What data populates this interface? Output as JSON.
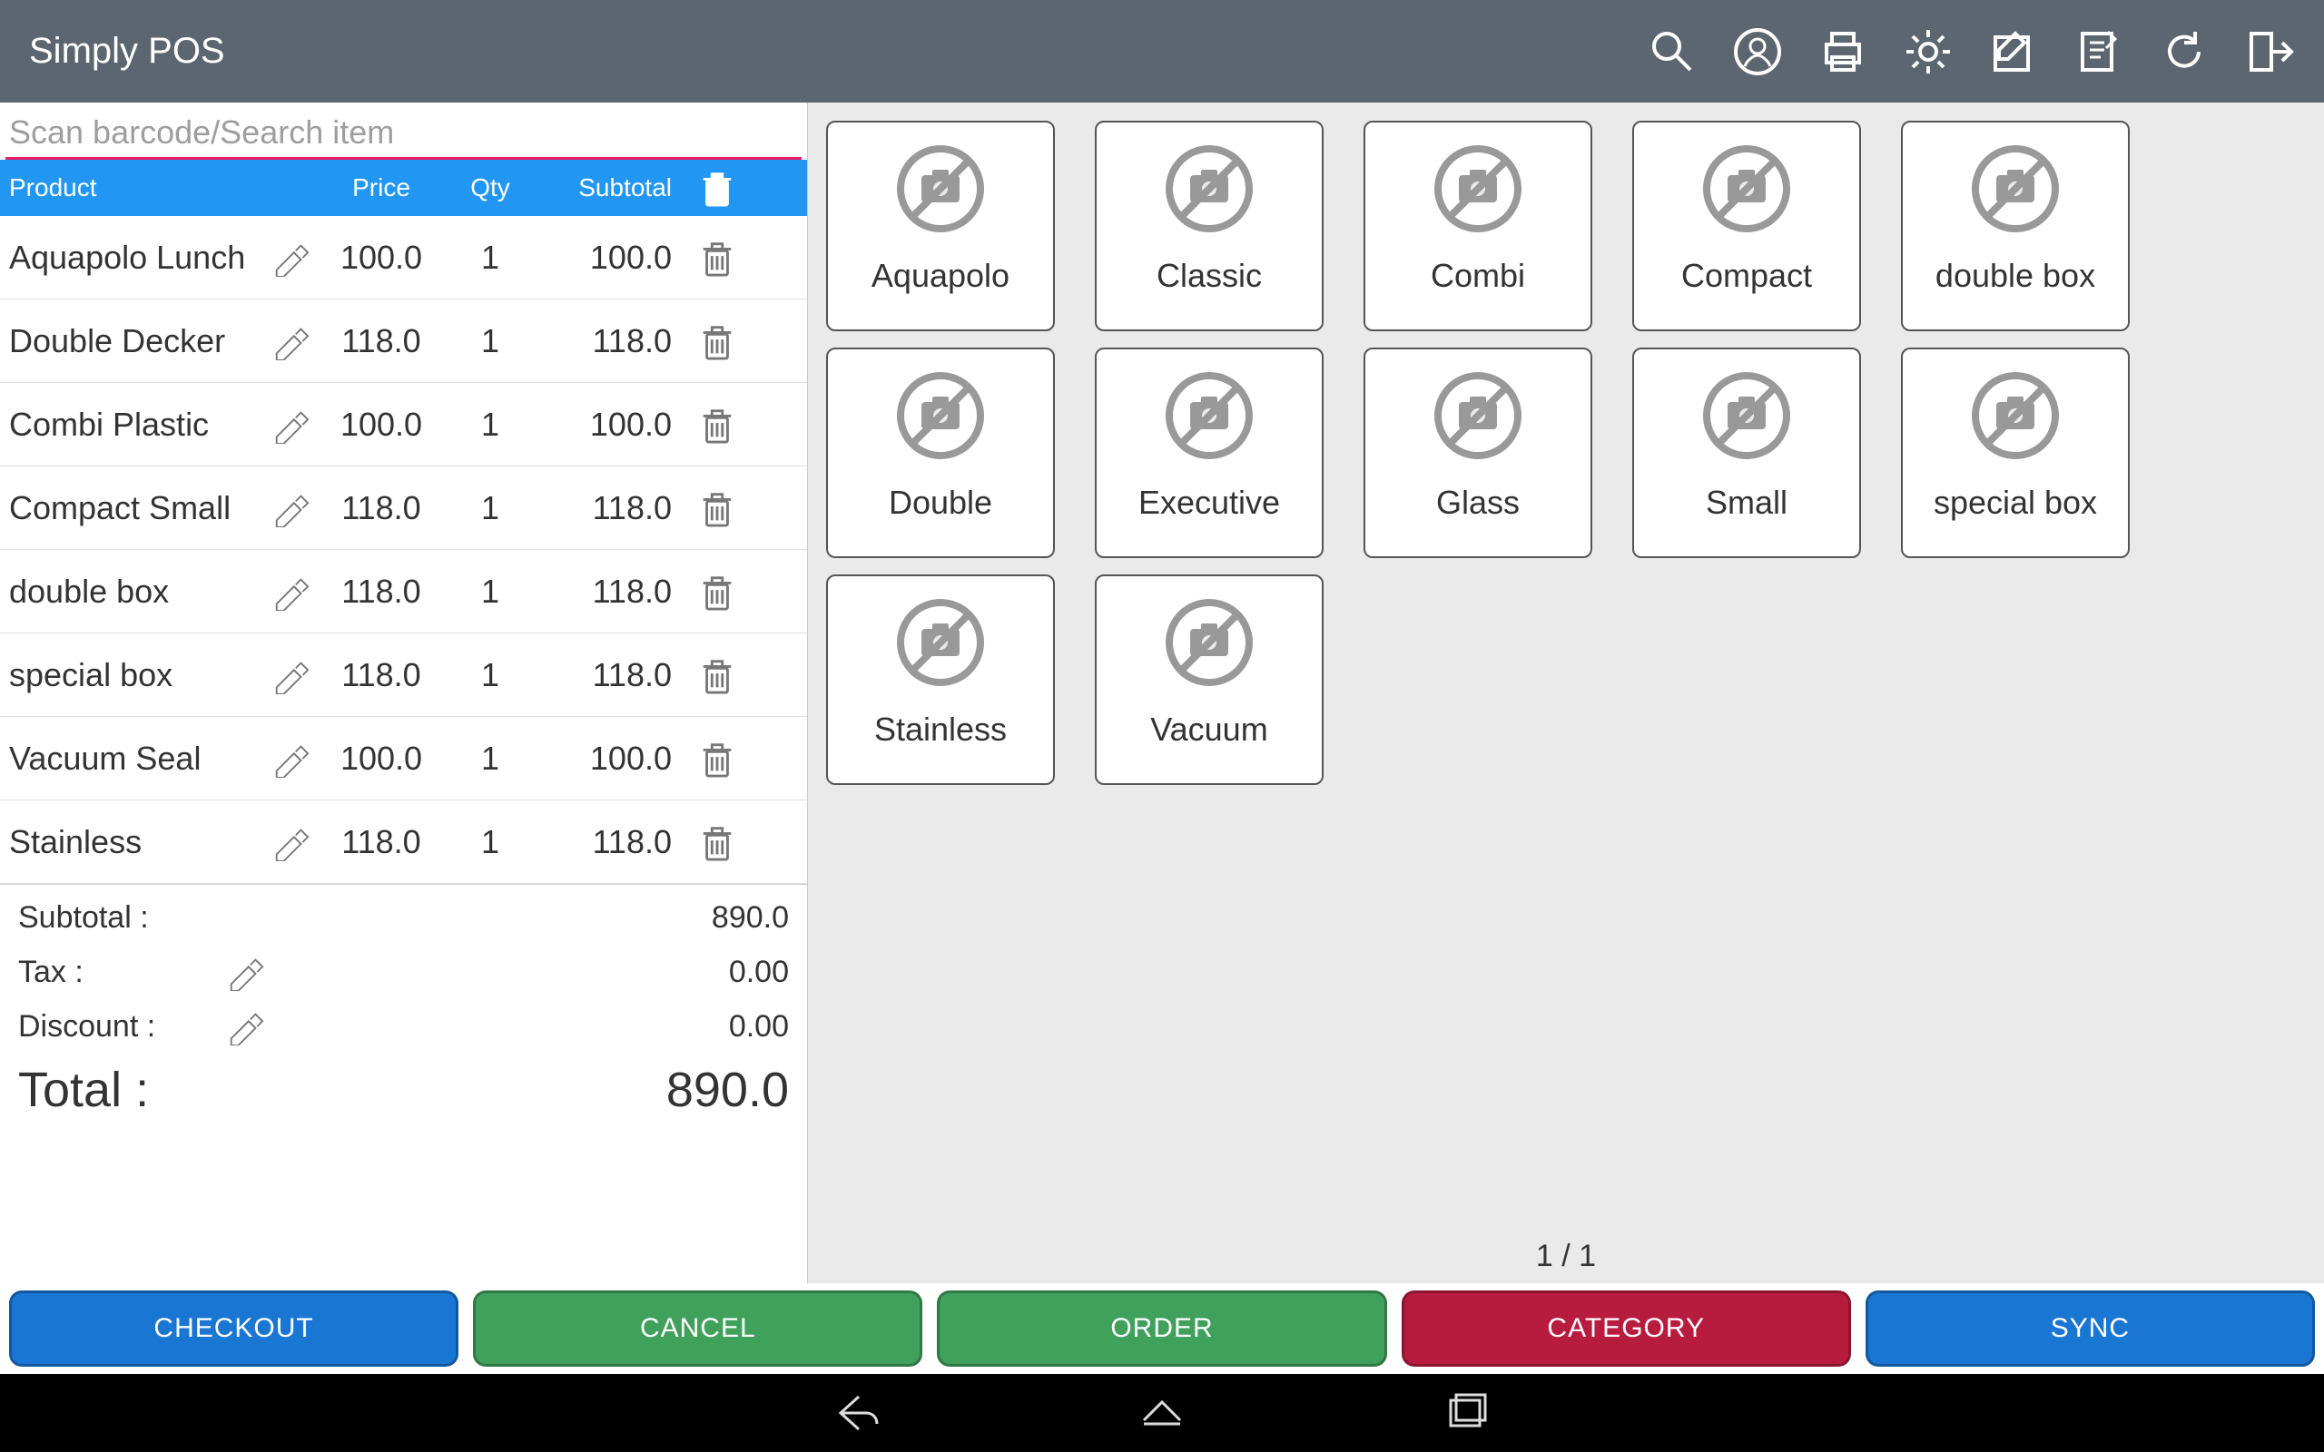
{
  "header": {
    "title": "Simply POS"
  },
  "search": {
    "placeholder": "Scan barcode/Search item",
    "value": ""
  },
  "cart": {
    "columns": {
      "product": "Product",
      "price": "Price",
      "qty": "Qty",
      "subtotal": "Subtotal"
    },
    "rows": [
      {
        "name": "Aquapolo Lunch",
        "price": "100.0",
        "qty": "1",
        "subtotal": "100.0"
      },
      {
        "name": "Double Decker",
        "price": "118.0",
        "qty": "1",
        "subtotal": "118.0"
      },
      {
        "name": "Combi Plastic",
        "price": "100.0",
        "qty": "1",
        "subtotal": "100.0"
      },
      {
        "name": "Compact Small",
        "price": "118.0",
        "qty": "1",
        "subtotal": "118.0"
      },
      {
        "name": "double box",
        "price": "118.0",
        "qty": "1",
        "subtotal": "118.0"
      },
      {
        "name": "special box",
        "price": "118.0",
        "qty": "1",
        "subtotal": "118.0"
      },
      {
        "name": "Vacuum Seal",
        "price": "100.0",
        "qty": "1",
        "subtotal": "100.0"
      },
      {
        "name": "Stainless",
        "price": "118.0",
        "qty": "1",
        "subtotal": "118.0"
      }
    ],
    "totals": {
      "subtotal_label": "Subtotal :",
      "subtotal": "890.0",
      "tax_label": "Tax :",
      "tax": "0.00",
      "discount_label": "Discount :",
      "discount": "0.00",
      "total_label": "Total :",
      "total": "890.0"
    }
  },
  "products": [
    {
      "label": "Aquapolo"
    },
    {
      "label": "Classic"
    },
    {
      "label": "Combi"
    },
    {
      "label": "Compact"
    },
    {
      "label": "double box"
    },
    {
      "label": "Double"
    },
    {
      "label": "Executive"
    },
    {
      "label": "Glass"
    },
    {
      "label": "Small"
    },
    {
      "label": "special box"
    },
    {
      "label": "Stainless"
    },
    {
      "label": "Vacuum"
    }
  ],
  "pager": {
    "text": "1 / 1"
  },
  "actions": {
    "checkout": "CHECKOUT",
    "cancel": "CANCEL",
    "order": "ORDER",
    "category": "CATEGORY",
    "sync": "SYNC"
  }
}
